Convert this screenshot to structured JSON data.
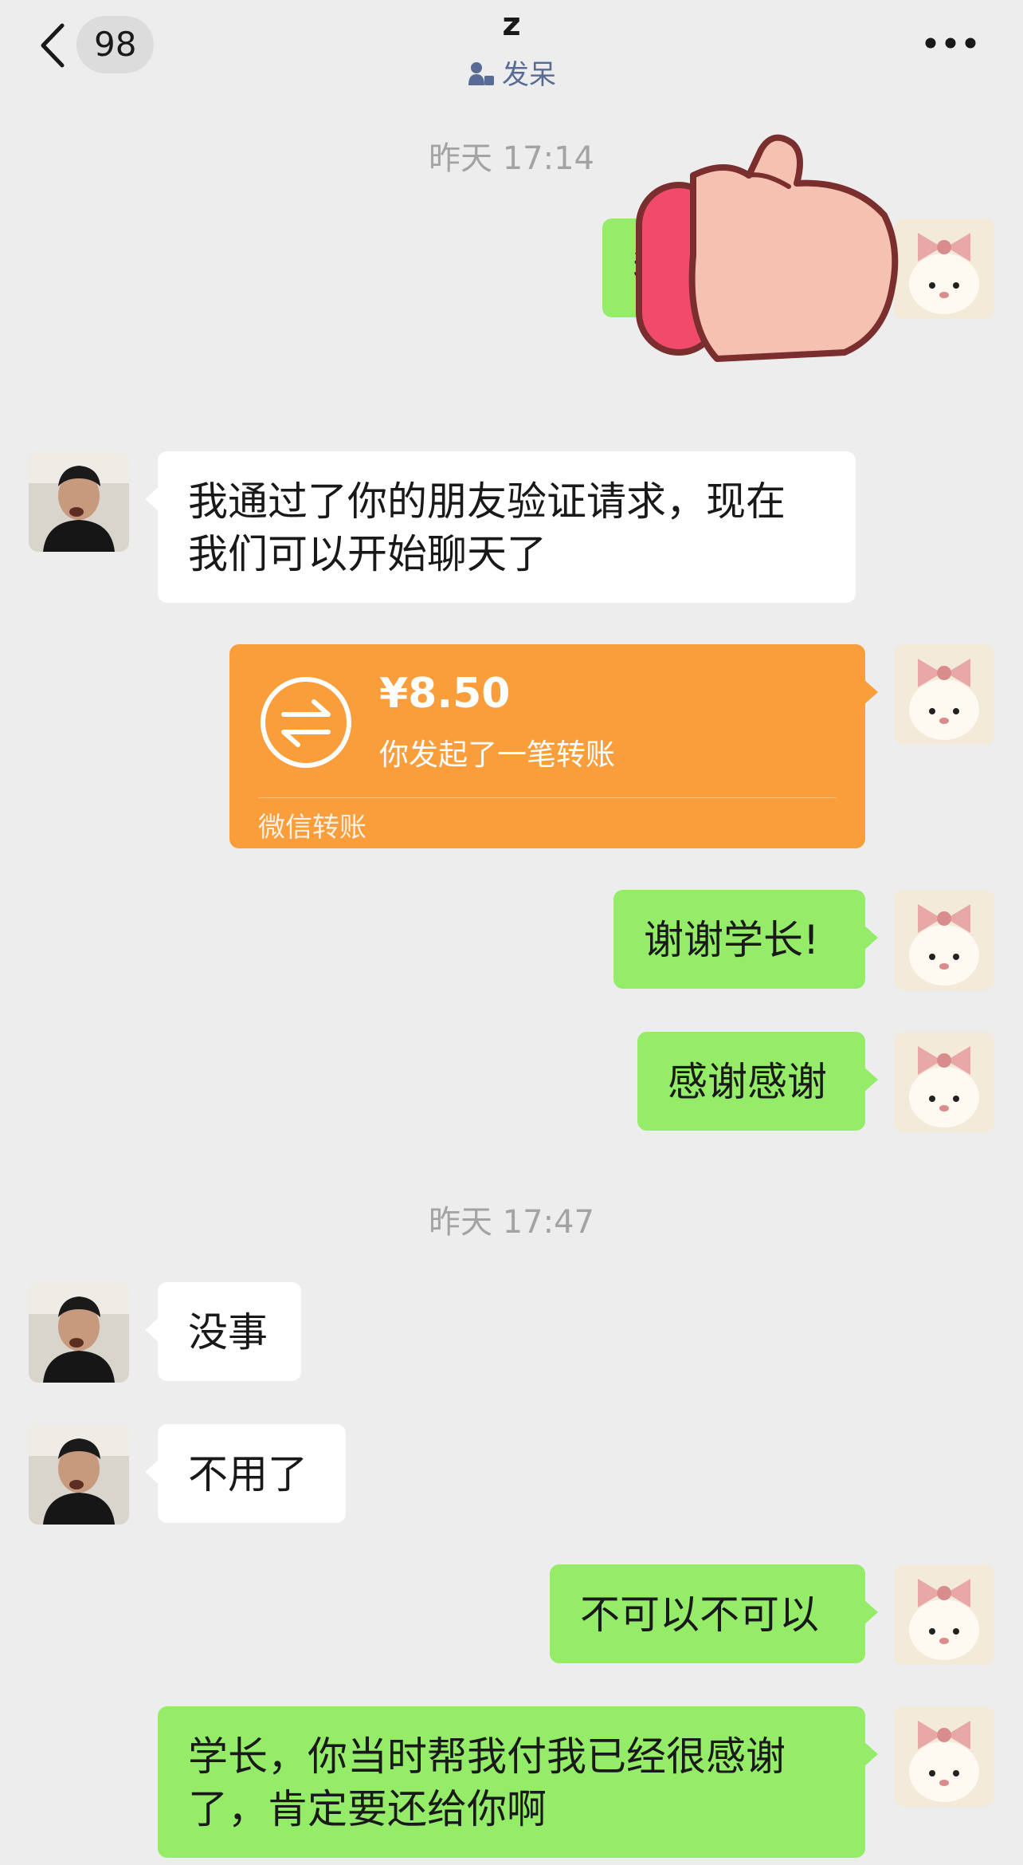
{
  "header": {
    "back_icon": "chevron-left-icon",
    "unread_count": "98",
    "title": "z",
    "status_text": "发呆",
    "status_icon": "person-status-icon",
    "more_icon": "more-dots-icon"
  },
  "messages": {
    "ts1": "昨天 17:14",
    "m1": "我是",
    "m2_line1": "我通过了你的朋友验证请求，现在",
    "m2_line2": "我们可以开始聊天了",
    "transfer": {
      "amount": "¥8.50",
      "desc": "你发起了一笔转账",
      "footer": "微信转账",
      "icon": "transfer-arrows-icon",
      "color": "#fa9d3b"
    },
    "m4": "谢谢学长!",
    "m5": "感谢感谢",
    "ts2": "昨天 17:47",
    "m6": "没事",
    "m7": "不用了",
    "m8": "不可以不可以",
    "m9_line1": "学长，你当时帮我付我已经很感谢",
    "m9_line2": "了，肯定要还给你啊"
  },
  "colors": {
    "background": "#ededed",
    "outgoing_bubble": "#95ec69",
    "incoming_bubble": "#ffffff",
    "status_text": "#576b95"
  },
  "overlay": {
    "icon": "thumbs-up-reaction-icon"
  }
}
